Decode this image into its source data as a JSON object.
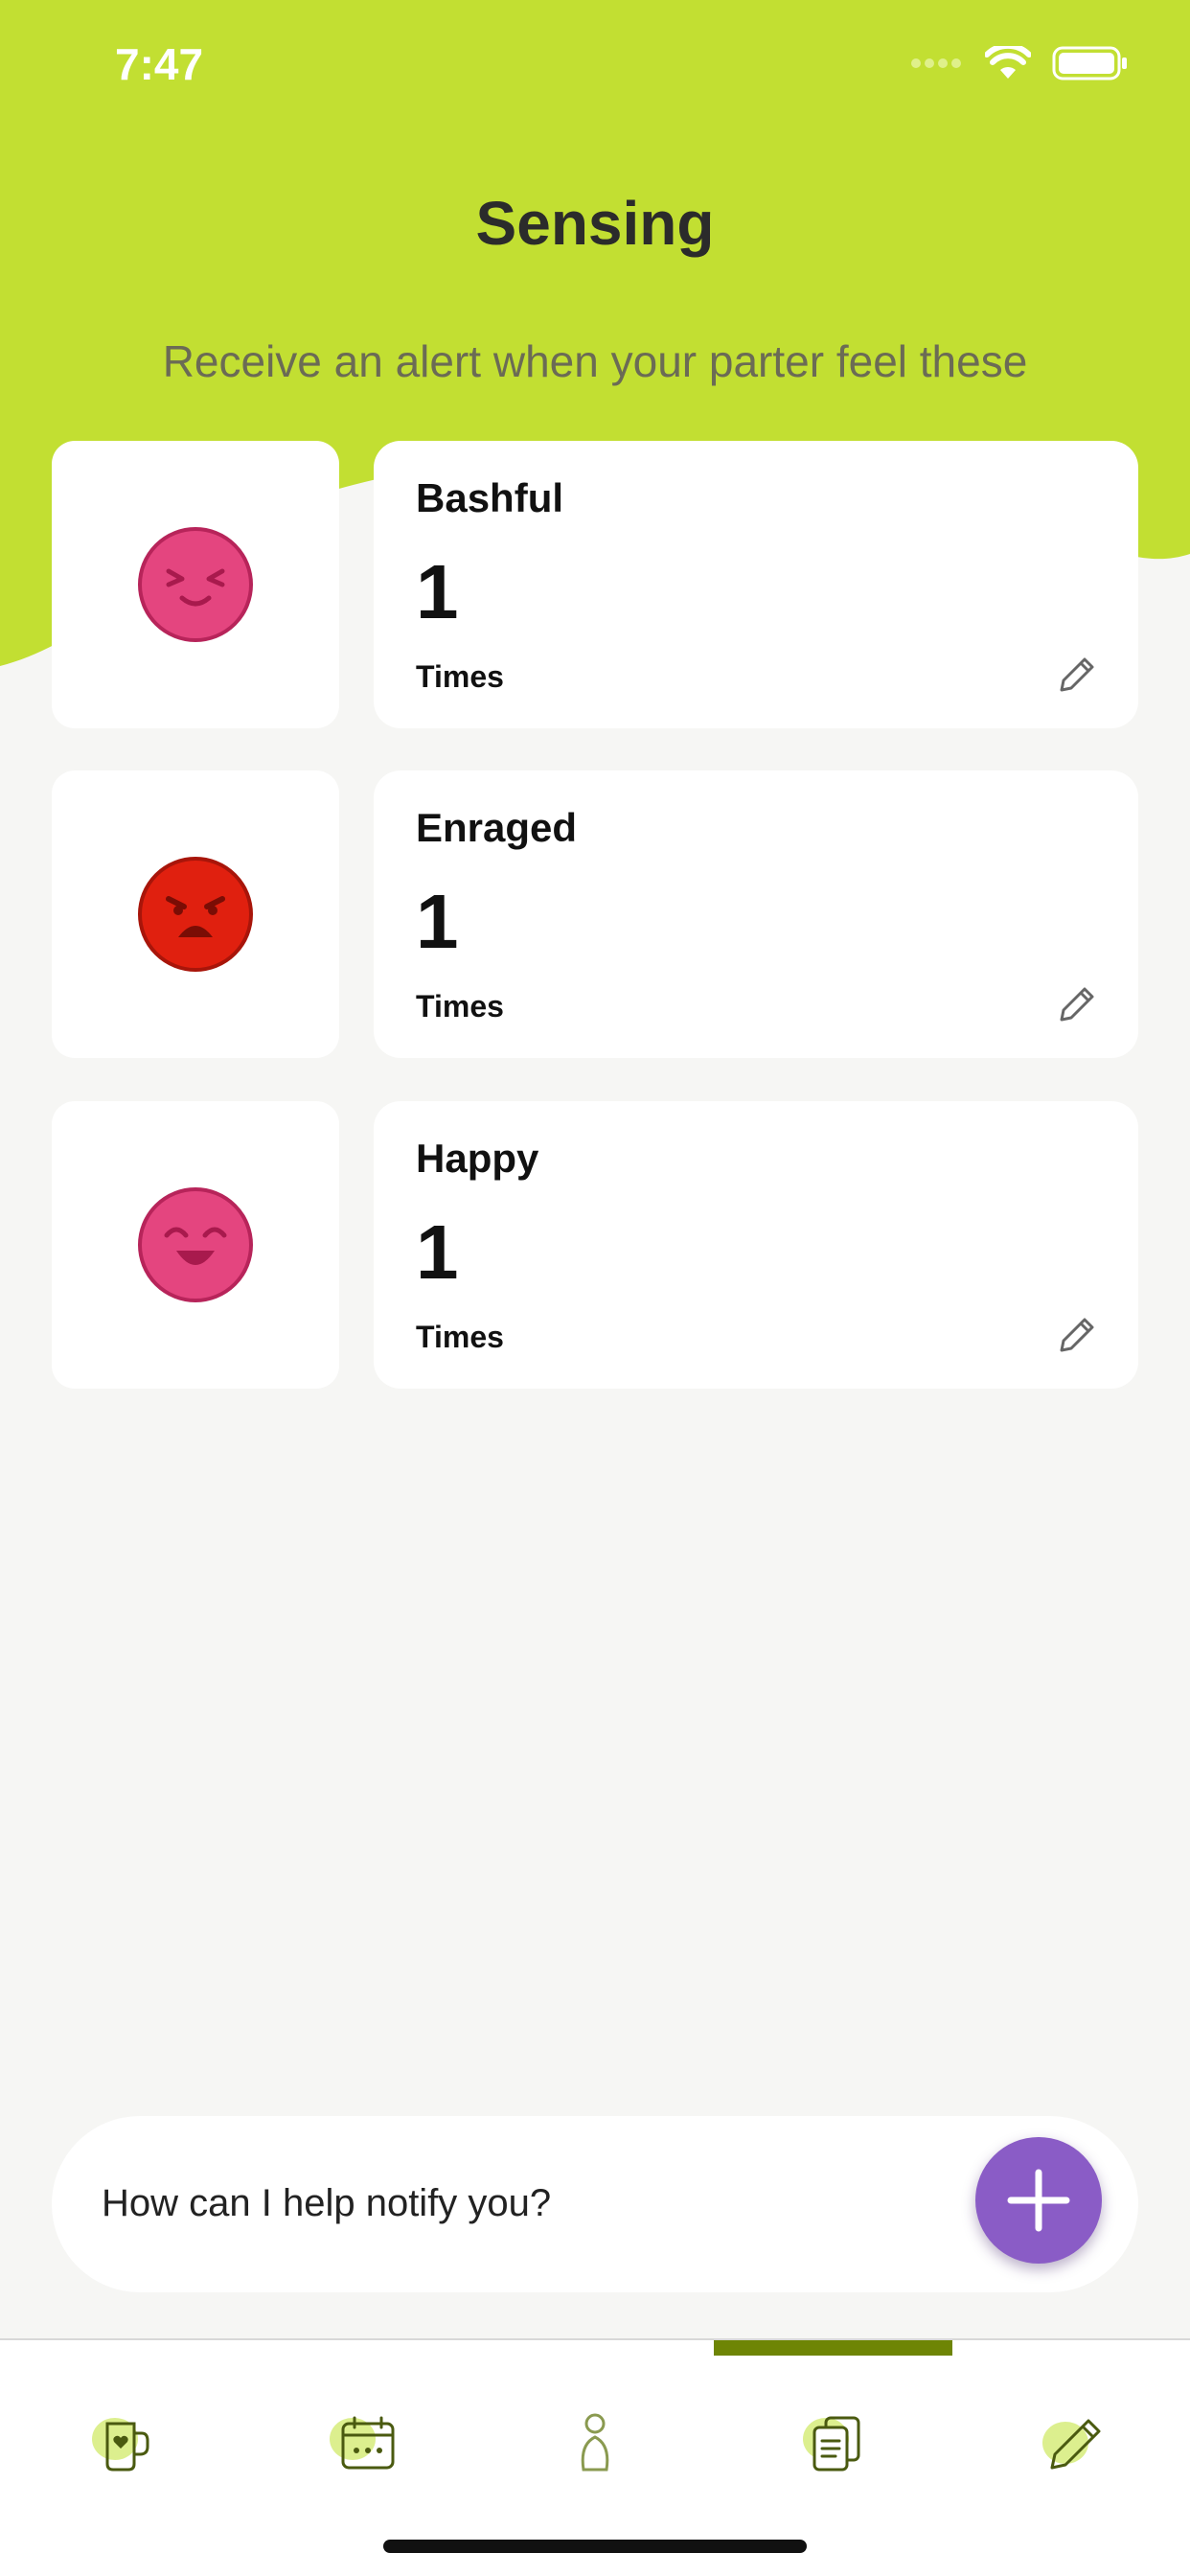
{
  "status_bar": {
    "time": "7:47"
  },
  "header": {
    "title": "Sensing",
    "subtitle": "Receive an alert when your parter feel these"
  },
  "moods": [
    {
      "name": "Bashful",
      "count": "1",
      "unit": "Times",
      "icon": "bashful-face-icon",
      "color": "#e4457f"
    },
    {
      "name": "Enraged",
      "count": "1",
      "unit": "Times",
      "icon": "enraged-face-icon",
      "color": "#e0200f"
    },
    {
      "name": "Happy",
      "count": "1",
      "unit": "Times",
      "icon": "happy-face-icon",
      "color": "#e4457f"
    }
  ],
  "chat": {
    "placeholder": "How can I help notify you?"
  },
  "tabs": [
    {
      "icon": "mug-heart-icon",
      "active": false
    },
    {
      "icon": "calendar-icon",
      "active": false
    },
    {
      "icon": "person-icon",
      "active": false
    },
    {
      "icon": "documents-icon",
      "active": true
    },
    {
      "icon": "pencil-icon",
      "active": false
    }
  ],
  "colors": {
    "header": "#c2df32",
    "accent_fab": "#8a5cc6",
    "tab_indicator": "#6e8505",
    "background": "#f6f6f4"
  }
}
